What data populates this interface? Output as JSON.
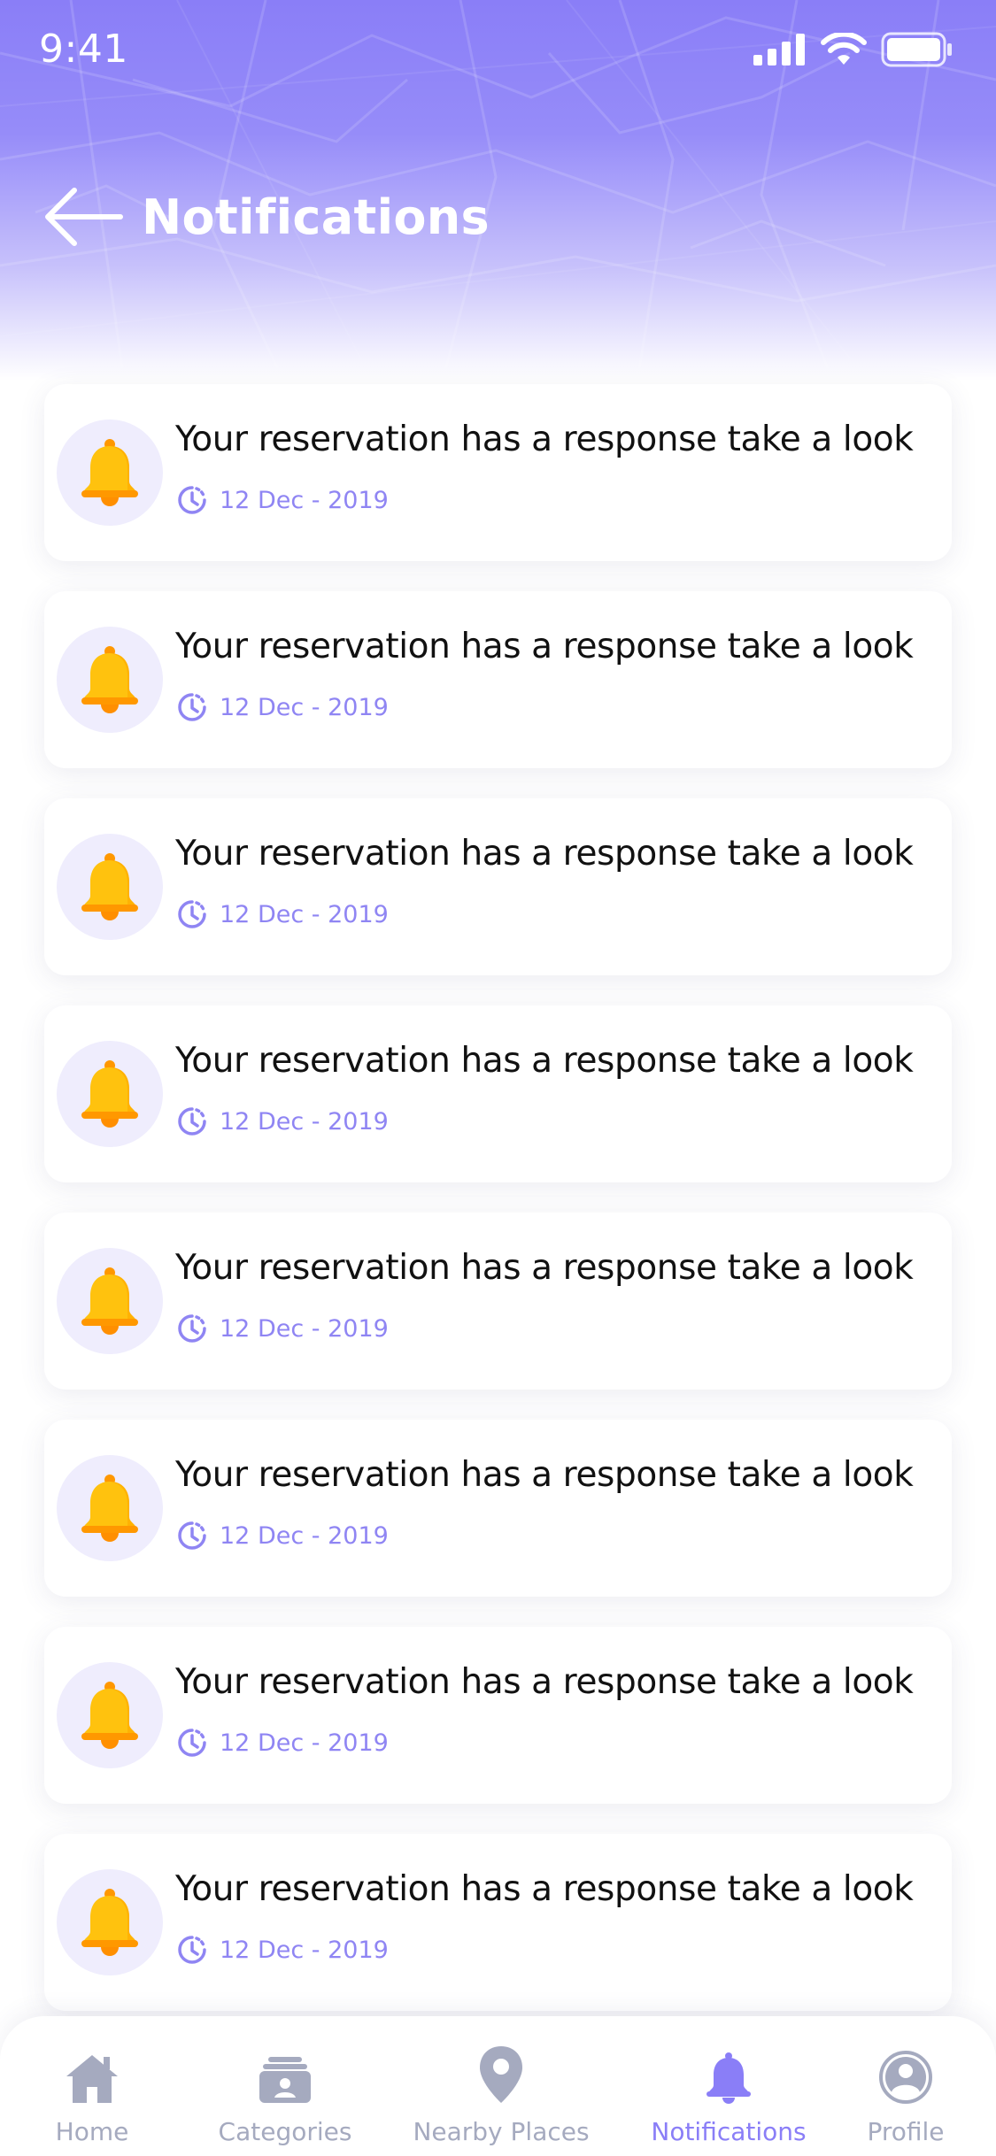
{
  "status_bar": {
    "time": "9:41",
    "icons": [
      "signal-icon",
      "wifi-icon",
      "battery-icon"
    ]
  },
  "header": {
    "title": "Notifications",
    "back_icon": "arrow-left-icon"
  },
  "notifications": [
    {
      "message": "Your reservation has a response take a look",
      "date": "12 Dec - 2019"
    },
    {
      "message": "Your reservation has a response take a look",
      "date": "12 Dec - 2019"
    },
    {
      "message": "Your reservation has a response take a look",
      "date": "12 Dec - 2019"
    },
    {
      "message": "Your reservation has a response take a look",
      "date": "12 Dec - 2019"
    },
    {
      "message": "Your reservation has a response take a look",
      "date": "12 Dec - 2019"
    },
    {
      "message": "Your reservation has a response take a look",
      "date": "12 Dec - 2019"
    },
    {
      "message": "Your reservation has a response take a look",
      "date": "12 Dec - 2019"
    },
    {
      "message": "Your reservation has a response take a look",
      "date": "12 Dec - 2019"
    }
  ],
  "bottom_nav": {
    "items": [
      {
        "label": "Home",
        "icon": "home-icon",
        "active": false
      },
      {
        "label": "Categories",
        "icon": "categories-icon",
        "active": false
      },
      {
        "label": "Nearby Places",
        "icon": "location-pin-icon",
        "active": false
      },
      {
        "label": "Notifications",
        "icon": "bell-icon",
        "active": true
      },
      {
        "label": "Profile",
        "icon": "profile-icon",
        "active": false
      }
    ]
  },
  "colors": {
    "accent": "#8a7ef7",
    "header_gradient_top": "#8a7ef7",
    "date_text": "#8f85f3",
    "bell_yellow": "#ffc20e",
    "bell_orange": "#ff9800",
    "nav_inactive": "#a5aabf",
    "bell_circle_bg": "#efedfd"
  }
}
